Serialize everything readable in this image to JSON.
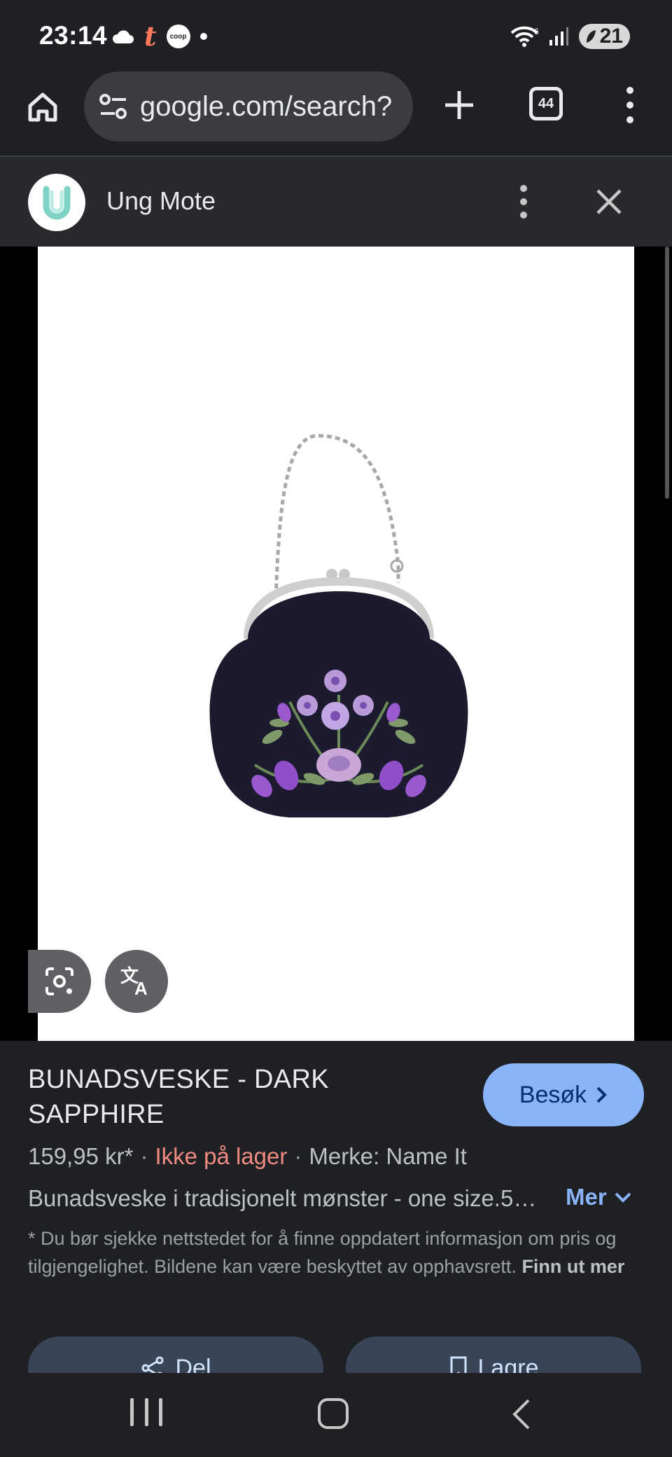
{
  "status_bar": {
    "time": "23:14",
    "battery": "21",
    "coop_label": "coop",
    "t_label": "t",
    "wifi_badge": "6"
  },
  "browser": {
    "url": "google.com/search?",
    "tab_count": "44"
  },
  "source": {
    "name": "Ung Mote"
  },
  "product": {
    "title": "BUNADSVESKE - DARK SAPPHIRE",
    "price": "159,95 kr*",
    "stock": "Ikke på lager",
    "brand": "Merke: Name It",
    "description": "Bunadsveske i tradisjonelt mønster - one size.5…",
    "more_label": "Mer",
    "visit_label": "Besøk",
    "disclaimer": "* Du bør sjekke nettstedet for å finne oppdatert informasjon om pris og tilgjengelighet. Bildene kan være beskyttet av opphavsrett.",
    "learn_more": "Finn ut mer"
  },
  "actions": {
    "share_label": "Del",
    "save_label": "Lagre"
  },
  "icons": {
    "home": "home-icon",
    "tune": "site-settings-icon",
    "new_tab": "plus-icon",
    "tabs": "tab-switcher-icon",
    "menu": "more-vert-icon",
    "close": "close-icon",
    "lens": "google-lens-icon",
    "translate": "translate-icon",
    "share": "share-icon",
    "bookmark": "bookmark-icon"
  },
  "colors": {
    "background": "#1f2023",
    "accent": "#8ab4f8",
    "stock_warning": "#f28b82",
    "bag": "#1b1a2e",
    "flower_purple": "#9b59d0"
  }
}
